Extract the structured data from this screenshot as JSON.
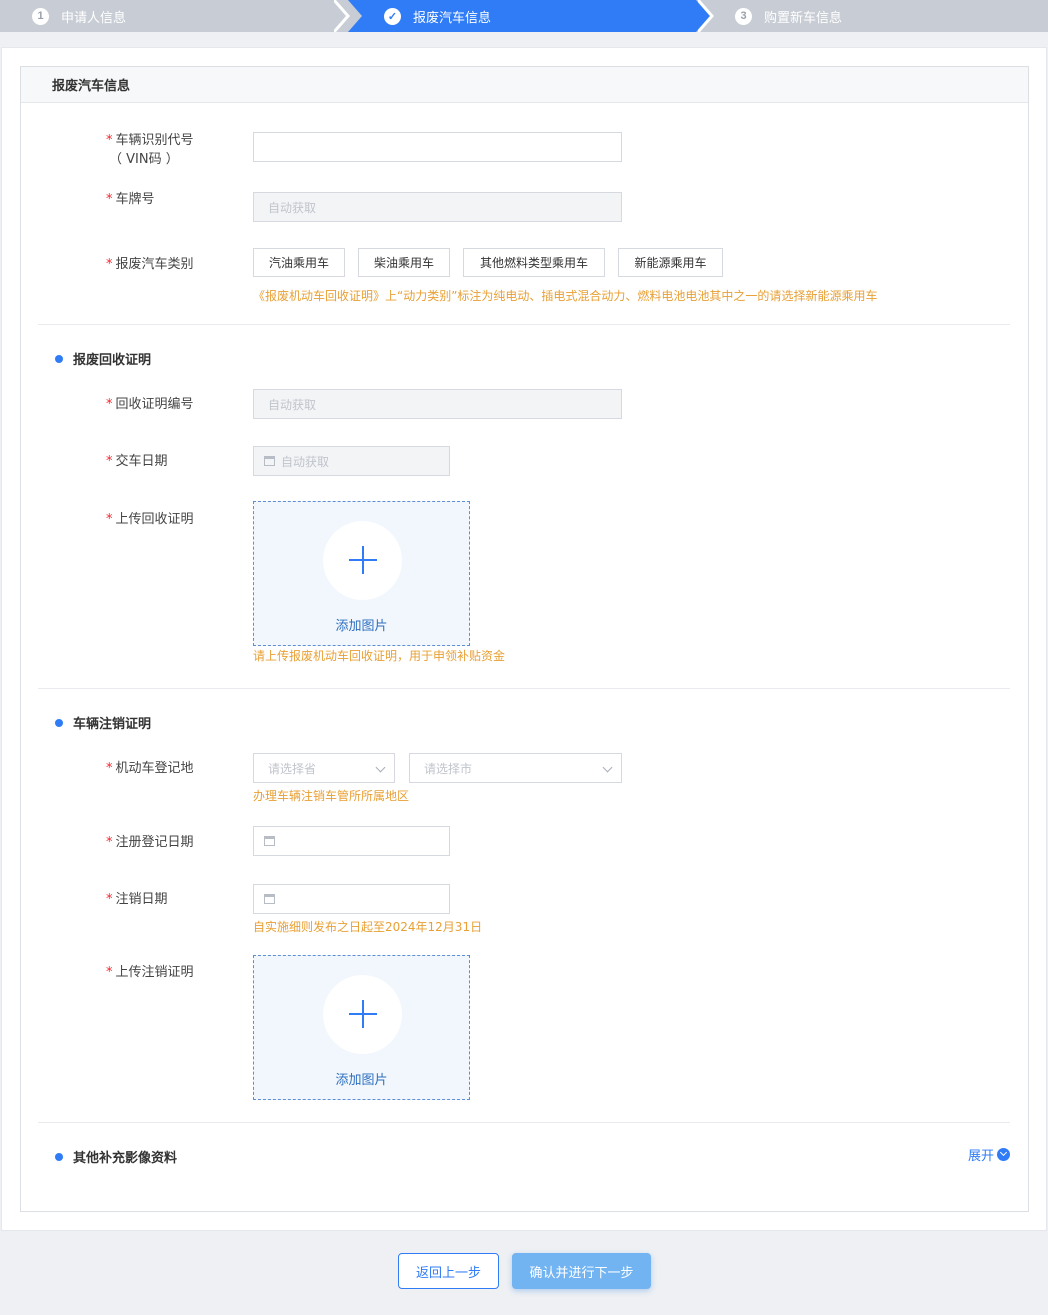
{
  "stepper": {
    "steps": [
      {
        "num": "1",
        "label": "申请人信息"
      },
      {
        "num": "✓",
        "label": "报废汽车信息"
      },
      {
        "num": "3",
        "label": "购置新车信息"
      }
    ]
  },
  "card": {
    "title": "报废汽车信息"
  },
  "vehicle": {
    "vin_label_line1": "车辆识别代号",
    "vin_label_line2": "（ VIN码 ）",
    "vin_value": "",
    "plate_label": "车牌号",
    "plate_placeholder": "自动获取",
    "type_label": "报废汽车类别",
    "types": [
      "汽油乘用车",
      "柴油乘用车",
      "其他燃料类型乘用车",
      "新能源乘用车"
    ],
    "type_hint": "《报废机动车回收证明》上“动力类别”标注为纯电动、插电式混合动力、燃料电池电池其中之一的请选择新能源乘用车"
  },
  "recycle": {
    "section_title": "报废回收证明",
    "cert_no_label": "回收证明编号",
    "cert_no_placeholder": "自动获取",
    "handover_label": "交车日期",
    "handover_placeholder": "自动获取",
    "upload_label": "上传回收证明",
    "upload_text": "添加图片",
    "upload_hint": "请上传报废机动车回收证明，用于申领补贴资金"
  },
  "deregister": {
    "section_title": "车辆注销证明",
    "region_label": "机动车登记地",
    "province_placeholder": "请选择省",
    "city_placeholder": "请选择市",
    "region_hint": "办理车辆注销车管所所属地区",
    "reg_date_label": "注册登记日期",
    "cancel_date_label": "注销日期",
    "cancel_hint": "自实施细则发布之日起至2024年12月31日",
    "upload_label": "上传注销证明",
    "upload_text": "添加图片"
  },
  "other": {
    "section_title": "其他补充影像资料",
    "expand_label": "展开"
  },
  "footer": {
    "back_label": "返回上一步",
    "next_label": "确认并进行下一步"
  },
  "colors": {
    "accent": "#2f7cf6",
    "hint": "#e8a035",
    "required": "#f5222d"
  }
}
